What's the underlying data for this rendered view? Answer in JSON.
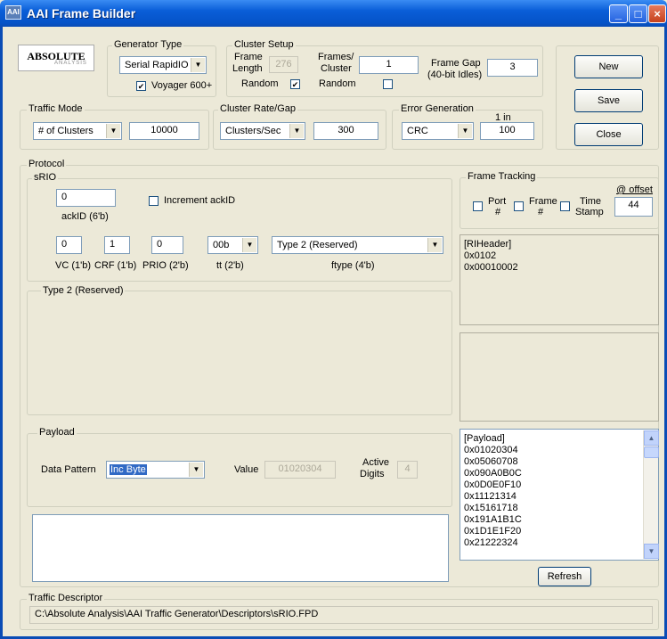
{
  "window": {
    "title": "AAI Frame Builder",
    "minimize": "_",
    "maximize": "□",
    "close": "×"
  },
  "logo": {
    "brand": "ABSOLUTE",
    "subtitle": "ANALYSIS"
  },
  "generator": {
    "legend": "Generator Type",
    "value": "Serial RapidIO",
    "voyager_label": "Voyager 600+",
    "voyager_checked": true
  },
  "cluster_setup": {
    "legend": "Cluster Setup",
    "frame_length_label_1": "Frame",
    "frame_length_label_2": "Length",
    "frame_length_value": "276",
    "frames_cluster_label_1": "Frames/",
    "frames_cluster_label_2": "Cluster",
    "frames_cluster_value": "1",
    "frame_gap_label_1": "Frame Gap",
    "frame_gap_label_2": "(40-bit Idles)",
    "frame_gap_value": "3",
    "random1_label": "Random",
    "random1_checked": true,
    "random2_label": "Random",
    "random2_checked": false
  },
  "buttons": {
    "new": "New",
    "save": "Save",
    "close": "Close",
    "refresh": "Refresh"
  },
  "traffic_mode": {
    "legend": "Traffic Mode",
    "value": "# of Clusters",
    "count": "10000"
  },
  "cluster_rate": {
    "legend": "Cluster Rate/Gap",
    "value": "Clusters/Sec",
    "rate": "300"
  },
  "error_generation": {
    "legend": "Error Generation",
    "one_in_label": "1 in",
    "value": "CRC",
    "rate": "100"
  },
  "protocol": {
    "legend": "Protocol",
    "srio": {
      "legend": "sRIO",
      "ackid_value": "0",
      "ackid_label": "ackID (6'b)",
      "increment_label": "Increment ackID",
      "vc_value": "0",
      "vc_label": "VC (1'b)",
      "crf_value": "1",
      "crf_label": "CRF (1'b)",
      "prio_value": "0",
      "prio_label": "PRIO (2'b)",
      "tt_value": "00b",
      "tt_label": "tt (2'b)",
      "ftype_value": "Type 2 (Reserved)",
      "ftype_label": "ftype (4'b)"
    },
    "type_box_legend": "Type 2 (Reserved)"
  },
  "frame_tracking": {
    "legend": "Frame Tracking",
    "port_label_1": "Port",
    "port_label_2": "#",
    "frame_label_1": "Frame",
    "frame_label_2": "#",
    "time_label_1": "Time",
    "time_label_2": "Stamp",
    "offset_label": "@ offset",
    "offset_value": "44"
  },
  "header_panel": {
    "lines": [
      "[RIHeader]",
      "0x0102",
      "0x00010002"
    ]
  },
  "payload": {
    "legend": "Payload",
    "data_pattern_label": "Data Pattern",
    "data_pattern_value": "Inc Byte",
    "value_label": "Value",
    "value_value": "01020304",
    "active_label_1": "Active",
    "active_label_2": "Digits",
    "active_value": "4"
  },
  "payload_list": {
    "lines": [
      "[Payload]",
      "0x01020304",
      "0x05060708",
      "0x090A0B0C",
      "0x0D0E0F10",
      "0x11121314",
      "0x15161718",
      "0x191A1B1C",
      "0x1D1E1F20",
      "0x21222324"
    ],
    "scroll_up": "▲",
    "scroll_down": "▼"
  },
  "traffic_descriptor": {
    "legend": "Traffic Descriptor",
    "path": "C:\\Absolute Analysis\\AAI Traffic Generator\\Descriptors\\sRIO.FPD"
  }
}
